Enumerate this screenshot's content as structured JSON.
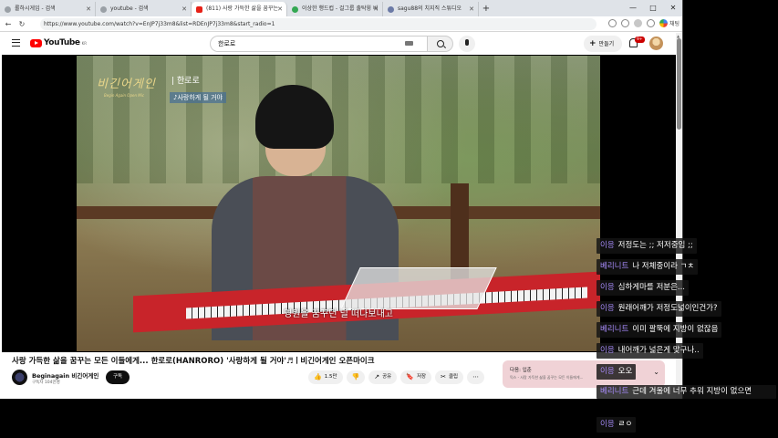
{
  "tabs": [
    {
      "label": "롤하시게임 - 검색",
      "icon": "search-icon"
    },
    {
      "label": "youtube - 검색",
      "icon": "search-icon"
    },
    {
      "label": "(811) 사랑 가득한 삶을 꿈꾸는",
      "icon": "youtube-icon"
    },
    {
      "label": "이상한 행드컵 - 걸그룹 출탁윙 비",
      "icon": "game-icon"
    },
    {
      "label": "sagu88의 치지직 스튜디오",
      "icon": "studio-icon"
    }
  ],
  "window": {
    "minimize": "—",
    "maximize": "□",
    "close": "✕"
  },
  "address": {
    "url": "https://www.youtube.com/watch?v=EnJP7j33m8&list=RDEnJP7j33m8&start_radio=1",
    "profile": "채팅"
  },
  "youtube": {
    "logo": "YouTube",
    "region": "KR",
    "search_value": "한로로",
    "create_label": "만들기",
    "notif_count": "9+"
  },
  "video": {
    "channel_logo": "비긴어게인",
    "channel_logo_sub": "Begin Again Open Mic",
    "artist": "| 한로로",
    "song": "♪사랑하게 될 거야",
    "subtitle": "영원을 꿈꾸던 널 떠나보내고",
    "title": "사랑 가득한 삶을 꿈꾸는 모든 이들에게... 한로로(HANRORO) '사랑하게 될 거야'♬ㅣ비긴어게인 오픈마이크"
  },
  "channel": {
    "name": "Beginagain 비긴어게인",
    "subs": "구독자 104만명",
    "subscribe": "구독"
  },
  "actions": [
    {
      "name": "like-button",
      "icon": "👍",
      "label": "1.5만"
    },
    {
      "name": "dislike-button",
      "icon": "👎",
      "label": ""
    },
    {
      "name": "share-button",
      "icon": "↗",
      "label": "공유"
    },
    {
      "name": "save-button",
      "icon": "🔖",
      "label": "저장"
    },
    {
      "name": "clip-button",
      "icon": "✂",
      "label": "클립"
    },
    {
      "name": "more-button",
      "icon": "⋯",
      "label": ""
    }
  ],
  "upnext": {
    "label": "다음: 입춘",
    "sub": "믹스 - 사랑 가득한 삶을 꿈꾸는 모든 이들에게...",
    "chevron": "⌄"
  },
  "chat": [
    {
      "nick": "이응",
      "text": "저정도는 ;; 저저중임 ;;"
    },
    {
      "nick": "베리니트",
      "text": "나 저체중이라 ㄱㅊ"
    },
    {
      "nick": "이응",
      "text": "심하게마를 저분은..."
    },
    {
      "nick": "이응",
      "text": "원래어깨가 저정도넓이인건가?"
    },
    {
      "nick": "베리니트",
      "text": "이미 팔뚝에 지방이 없잖음"
    },
    {
      "nick": "이응",
      "text": "내어깨가 넓은게 맞구나.."
    },
    {
      "nick": "이응",
      "text": "오오"
    },
    {
      "nick": "베리니트",
      "text": "근데 겨울에 너무 추워 지방이 없으면"
    },
    {
      "nick": "이응",
      "text": "ㄹㅇ"
    }
  ]
}
